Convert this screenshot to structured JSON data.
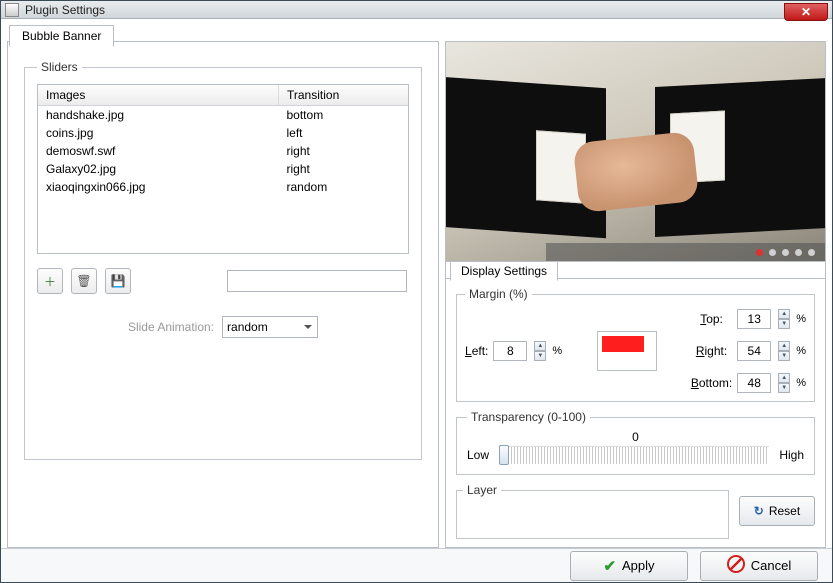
{
  "window": {
    "title": "Plugin Settings"
  },
  "left": {
    "tab_label": "Bubble Banner",
    "sliders_legend": "Sliders",
    "columns": {
      "images": "Images",
      "transition": "Transition"
    },
    "rows": [
      {
        "image": "handshake.jpg",
        "transition": "bottom"
      },
      {
        "image": "coins.jpg",
        "transition": "left"
      },
      {
        "image": "demoswf.swf",
        "transition": "right"
      },
      {
        "image": "Galaxy02.jpg",
        "transition": "right"
      },
      {
        "image": "xiaoqingxin066.jpg",
        "transition": "random"
      }
    ],
    "slide_animation_label": "Slide Animation:",
    "slide_animation_value": "random",
    "text_field_value": ""
  },
  "right": {
    "tab_label": "Display Settings",
    "preview_dot_count": 5,
    "preview_active_dot": 0,
    "margin": {
      "legend": "Margin (%)",
      "top_label": "Top:",
      "top_value": "13",
      "left_label": "Left:",
      "left_value": "8",
      "right_label": "Right:",
      "right_value": "54",
      "bottom_label": "Bottom:",
      "bottom_value": "48",
      "pct": "%",
      "swatch_color": "#ff1e1e"
    },
    "transparency": {
      "legend": "Transparency (0-100)",
      "low": "Low",
      "high": "High",
      "value": "0"
    },
    "layer_legend": "Layer",
    "reset_label": "Reset"
  },
  "footer": {
    "apply": "Apply",
    "cancel": "Cancel"
  }
}
